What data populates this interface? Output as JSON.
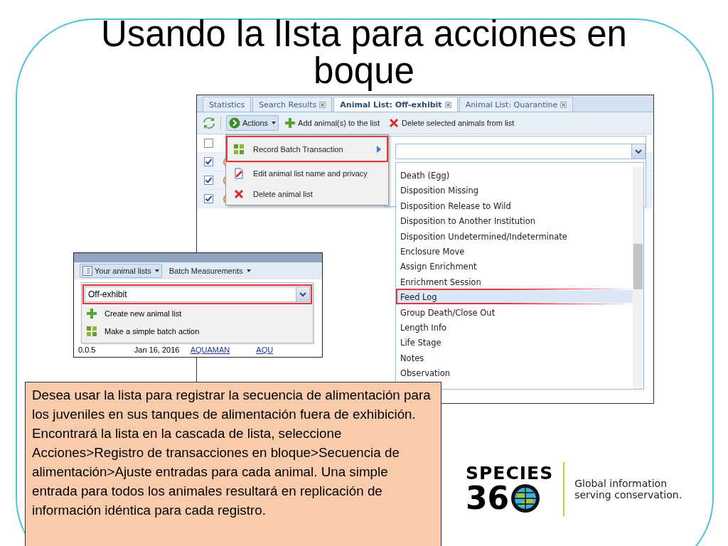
{
  "slide": {
    "title": "Usando la lIsta para acciones en boque",
    "note": "Desea usar la lista para registrar la secuencia de alimentación para los juveniles en sus tanques de alimentación fuera de exhibición. Encontrará la lista en la cascada de lista, seleccione Acciones>Registro de transacciones en bloque>Secuencia de alimentación>Ajuste entradas para cada animal. Una simple entrada para todos los animales resultará en replicación de información idéntica para cada registro."
  },
  "main_screenshot": {
    "tabs": [
      {
        "label": "Statistics",
        "selected": false,
        "closable": false
      },
      {
        "label": "Search Results",
        "selected": false,
        "closable": true
      },
      {
        "label": "Animal List: Off-exhibit",
        "selected": true,
        "closable": true
      },
      {
        "label": "Animal List: Quarantine",
        "selected": false,
        "closable": true
      }
    ],
    "toolbar": {
      "actions": "Actions",
      "add": "Add animal(s) to the list",
      "delete": "Delete selected animals from list"
    },
    "header_checkbox": {
      "checked": false
    },
    "rows": [
      {
        "checked": true
      },
      {
        "checked": true
      },
      {
        "checked": true
      }
    ],
    "actions_menu": [
      {
        "label": "Record Batch Transaction",
        "kind": "batch",
        "submenu": true,
        "highlighted": true
      },
      {
        "label": "Edit animal list name and privacy",
        "kind": "edit",
        "submenu": false,
        "highlighted": false
      },
      {
        "label": "Delete animal list",
        "kind": "delete",
        "submenu": false,
        "highlighted": false
      }
    ],
    "transaction_types": [
      {
        "label": "Death (Egg)",
        "selected": false,
        "highlighted": false
      },
      {
        "label": "Disposition Missing",
        "selected": false,
        "highlighted": false
      },
      {
        "label": "Disposition Release to Wild",
        "selected": false,
        "highlighted": false
      },
      {
        "label": "Disposition to Another Institution",
        "selected": false,
        "highlighted": false
      },
      {
        "label": "Disposition Undetermined/Indeterminate",
        "selected": false,
        "highlighted": false
      },
      {
        "label": "Enclosure Move",
        "selected": false,
        "highlighted": false
      },
      {
        "label": "Assign Enrichment",
        "selected": false,
        "highlighted": false
      },
      {
        "label": "Enrichment Session",
        "selected": false,
        "highlighted": false
      },
      {
        "label": "Feed Log",
        "selected": true,
        "highlighted": true
      },
      {
        "label": "Group Death/Close Out",
        "selected": false,
        "highlighted": false
      },
      {
        "label": "Length Info",
        "selected": false,
        "highlighted": false
      },
      {
        "label": "Life Stage",
        "selected": false,
        "highlighted": false
      },
      {
        "label": "Notes",
        "selected": false,
        "highlighted": false
      },
      {
        "label": "Observation",
        "selected": false,
        "highlighted": false
      }
    ]
  },
  "inset_screenshot": {
    "toolbar": [
      {
        "label": "Your animal lists",
        "kind": "lists",
        "pressed": true
      },
      {
        "label": "Batch Measurements",
        "kind": "plain",
        "pressed": false
      }
    ],
    "list_select": {
      "value": "Off-exhibit",
      "highlighted": true
    },
    "menu": [
      {
        "label": "Create new animal list",
        "kind": "add"
      },
      {
        "label": "Make a simple batch action",
        "kind": "batch"
      }
    ],
    "row": [
      {
        "text": "0.0.5",
        "kind": "text"
      },
      {
        "text": "Jan 16, 2016",
        "kind": "text"
      },
      {
        "text": "AQUAMAN",
        "kind": "link"
      },
      {
        "text": "AQU",
        "kind": "link"
      }
    ]
  },
  "logo": {
    "wordmark": "SPECIES",
    "number": "36",
    "tagline": "Global information serving conservation."
  }
}
